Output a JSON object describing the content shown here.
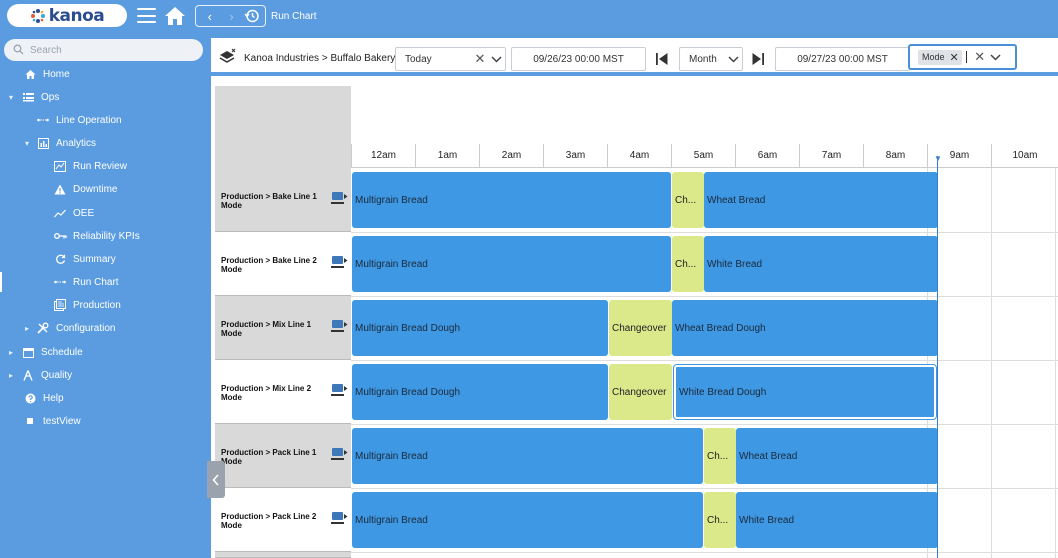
{
  "app": {
    "logo_text": "kanoa",
    "page_title": "Run Chart",
    "colors": {
      "nav_bg": "#5b9ce0",
      "bar_blue": "#3f98e4",
      "bar_changeover": "#dbe98a"
    }
  },
  "sidebar": {
    "search_placeholder": "Search",
    "items": [
      {
        "label": "Home",
        "icon": "home-icon"
      },
      {
        "label": "Ops",
        "icon": "ops-icon",
        "expanded": true
      },
      {
        "label": "Line Operation",
        "icon": "line-operation-icon"
      },
      {
        "label": "Analytics",
        "icon": "analytics-icon",
        "expanded": true
      },
      {
        "label": "Run Review",
        "icon": "run-review-icon"
      },
      {
        "label": "Downtime",
        "icon": "warning-icon"
      },
      {
        "label": "OEE",
        "icon": "trend-icon"
      },
      {
        "label": "Reliability KPIs",
        "icon": "key-icon"
      },
      {
        "label": "Summary",
        "icon": "refresh-icon"
      },
      {
        "label": "Run Chart",
        "icon": "run-chart-icon",
        "active": true
      },
      {
        "label": "Production",
        "icon": "production-icon"
      },
      {
        "label": "Configuration",
        "icon": "tools-icon"
      },
      {
        "label": "Schedule",
        "icon": "calendar-icon"
      },
      {
        "label": "Quality",
        "icon": "quality-icon"
      },
      {
        "label": "Help",
        "icon": "help-icon"
      },
      {
        "label": "testView",
        "icon": "square-icon"
      }
    ]
  },
  "toolbar": {
    "breadcrumb": "Kanoa Industries > Buffalo Bakery",
    "range_preset": "Today",
    "start_datetime": "09/26/23 00:00 MST",
    "interval": "Month",
    "end_datetime": "09/27/23 00:00 MST",
    "filter_chip": "Mode"
  },
  "timeline": {
    "hours": [
      "12am",
      "1am",
      "2am",
      "3am",
      "4am",
      "5am",
      "6am",
      "7am",
      "8am",
      "9am",
      "10am"
    ]
  },
  "rows": [
    {
      "label": "Production > Bake Line 1\nMode",
      "bars": [
        {
          "label": "Multigrain Bread",
          "type": "run"
        },
        {
          "label": "Ch...",
          "type": "changeover"
        },
        {
          "label": "Wheat Bread",
          "type": "run"
        }
      ]
    },
    {
      "label": "Production > Bake Line 2\nMode",
      "bars": [
        {
          "label": "Multigrain Bread",
          "type": "run"
        },
        {
          "label": "Ch...",
          "type": "changeover"
        },
        {
          "label": "White Bread",
          "type": "run"
        }
      ]
    },
    {
      "label": "Production > Mix Line 1\nMode",
      "bars": [
        {
          "label": "Multigrain Bread Dough",
          "type": "run"
        },
        {
          "label": "Changeover",
          "type": "changeover"
        },
        {
          "label": "Wheat Bread Dough",
          "type": "run"
        }
      ]
    },
    {
      "label": "Production > Mix Line 2\nMode",
      "bars": [
        {
          "label": "Multigrain Bread Dough",
          "type": "run"
        },
        {
          "label": "Changeover",
          "type": "changeover"
        },
        {
          "label": "White Bread Dough",
          "type": "run"
        }
      ]
    },
    {
      "label": "Production > Pack Line 1\nMode",
      "bars": [
        {
          "label": "Multigrain Bread",
          "type": "run"
        },
        {
          "label": "Ch...",
          "type": "changeover"
        },
        {
          "label": "Wheat Bread",
          "type": "run"
        }
      ]
    },
    {
      "label": "Production > Pack Line 2\nMode",
      "bars": [
        {
          "label": "Multigrain Bread",
          "type": "run"
        },
        {
          "label": "Ch...",
          "type": "changeover"
        },
        {
          "label": "White Bread",
          "type": "run"
        }
      ]
    }
  ]
}
